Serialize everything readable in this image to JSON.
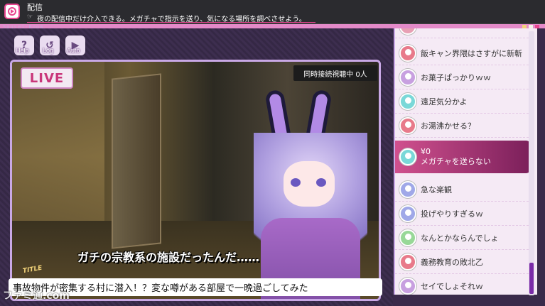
{
  "topbar": {
    "title": "配信",
    "subtitle": "夜の配信中だけ介入できる。メガチャで指示を送り、気になる場所を調べさせよう。"
  },
  "window": {
    "label": "Sousei-Room"
  },
  "controls": [
    {
      "label": "Help",
      "icon": "question-icon",
      "glyph": "?"
    },
    {
      "label": "Log",
      "icon": "log-icon",
      "glyph": "↺"
    },
    {
      "label": "Auto",
      "icon": "auto-icon",
      "glyph": "▶"
    }
  ],
  "stream": {
    "live_badge": "LIVE",
    "viewers": "同時接続視聴中 0人",
    "caption": "ガチの宗教系の施設だったんだ……"
  },
  "title_tag": "TITLE",
  "stream_title": "事故物件が密集する村に潜入！？変な噂がある部屋で一晩過ごしてみた",
  "chat": {
    "items": [
      {
        "text": "",
        "color": "#e8a0b4"
      },
      {
        "text": "飯キャン界隈はさすがに新斬",
        "color": "#e87a8a"
      },
      {
        "text": "お菓子ぱっかりｗｗ",
        "color": "#c8a0e0"
      },
      {
        "text": "遠足気分かよ",
        "color": "#7ad8d8"
      },
      {
        "text": "お湯沸かせる？",
        "color": "#e87a8a"
      },
      {
        "text": "急な楽観",
        "color": "#a0a8e8"
      },
      {
        "text": "投げやりすぎるｗ",
        "color": "#a0a8e8"
      },
      {
        "text": "なんとかならんでしょ",
        "color": "#98d898"
      },
      {
        "text": "義務教育の敗北乙",
        "color": "#e87a8a"
      },
      {
        "text": "セイでしょそれｗ",
        "color": "#c8a0e0"
      }
    ],
    "highlight": {
      "amount": "¥0",
      "text": "メガチャを送らない",
      "color": "#7ad8d8"
    }
  },
  "watermark": "ファミ通.com"
}
